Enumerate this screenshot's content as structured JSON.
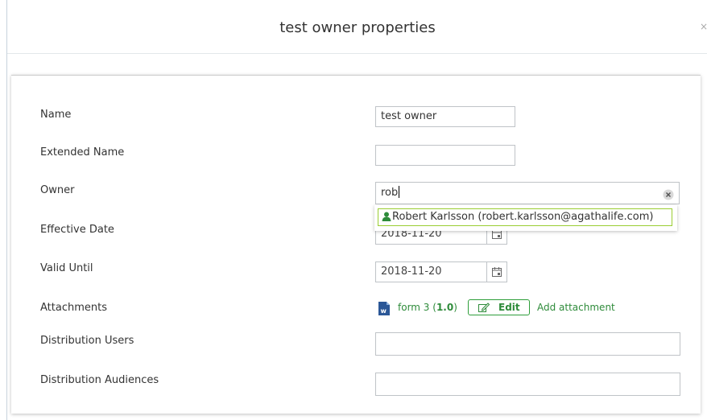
{
  "dialog": {
    "title": "test owner properties",
    "close": "×"
  },
  "form": {
    "name_label": "Name",
    "name_value": "test owner",
    "extended_name_label": "Extended Name",
    "extended_name_value": "",
    "owner_label": "Owner",
    "owner_value": "rob",
    "owner_suggestion": "Robert Karlsson (robert.karlsson@agathalife.com)",
    "effective_date_label": "Effective Date",
    "effective_date_value": "2018-11-20",
    "valid_until_label": "Valid Until",
    "valid_until_value": "2018-11-20",
    "attachments_label": "Attachments",
    "attachment_name": "form 3",
    "attachment_version": "1.0",
    "edit_label": "Edit",
    "add_attachment_label": "Add attachment",
    "distribution_users_label": "Distribution Users",
    "distribution_users_value": "",
    "distribution_audiences_label": "Distribution Audiences",
    "distribution_audiences_value": ""
  },
  "colors": {
    "accent_green": "#2e8b3a",
    "suggestion_border": "#9acd32"
  },
  "icons": {
    "calendar": "calendar-icon",
    "clear": "clear-circle-icon",
    "user": "user-icon",
    "word": "word-document-icon",
    "edit": "edit-pencil-icon"
  }
}
